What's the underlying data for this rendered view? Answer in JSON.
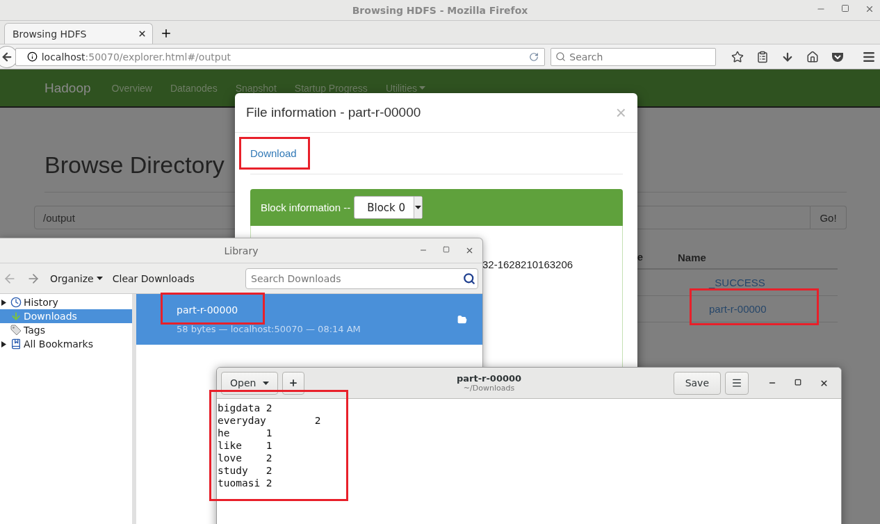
{
  "browser": {
    "window_title": "Browsing HDFS - Mozilla Firefox",
    "tabs": [
      {
        "label": "Browsing HDFS",
        "selected": true
      }
    ],
    "url": {
      "host": "localhost",
      "path": ":50070/explorer.html#/output"
    },
    "search": {
      "placeholder": "Search"
    }
  },
  "page": {
    "brand": "Hadoop",
    "nav": [
      "Overview",
      "Datanodes",
      "Snapshot",
      "Startup Progress",
      "Utilities"
    ],
    "heading": "Browse Directory",
    "path_field": {
      "value": "/output"
    },
    "go_button": "Go!",
    "table": {
      "columns": [
        "e",
        "Name"
      ],
      "rows": [
        {
          "name": "_SUCCESS"
        },
        {
          "name": "part-r-00000"
        }
      ]
    }
  },
  "modal": {
    "title": "File information - part-r-00000",
    "close": "×",
    "download_link": "Download",
    "block_panel": {
      "label": "Block information --",
      "select": "Block 0",
      "text": "32-1628210163206"
    }
  },
  "library": {
    "title": "Library",
    "organize": "Organize",
    "clear": "Clear Downloads",
    "search_placeholder": "Search Downloads",
    "sidebar": [
      {
        "label": "History",
        "kind": "history",
        "expandable": true,
        "selected": false
      },
      {
        "label": "Downloads",
        "kind": "downloads",
        "expandable": false,
        "selected": true
      },
      {
        "label": "Tags",
        "kind": "tags",
        "expandable": false,
        "selected": false
      },
      {
        "label": "All Bookmarks",
        "kind": "bookmarks",
        "expandable": true,
        "selected": false
      }
    ],
    "downloads": [
      {
        "name": "part-r-00000",
        "details": "58 bytes — localhost:50070 — 08:14 AM",
        "selected": true
      }
    ]
  },
  "editor": {
    "title": "part-r-00000",
    "subtitle": "~/Downloads",
    "open_button": "Open",
    "save_button": "Save",
    "lines": [
      "bigdata\t2",
      "everyday\t2",
      "he\t1",
      "like\t1",
      "love\t2",
      "study\t2",
      "tuomasi\t2"
    ]
  }
}
